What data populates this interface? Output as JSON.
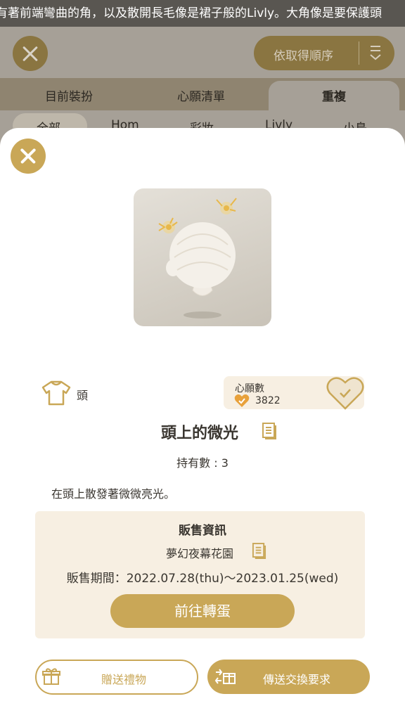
{
  "marquee": {
    "text": "有著前端彎曲的角，以及散開長毛像是裙子般的Livly。大角像是要保護頭"
  },
  "background_screen": {
    "sort_button_label": "依取得順序",
    "tabs": [
      "目前裝扮",
      "心願清單",
      "重複"
    ],
    "active_tab": "重複",
    "subtabs": [
      "全部",
      "Hom",
      "彩妝",
      "Livly",
      "小島"
    ]
  },
  "detail": {
    "category": "頭",
    "wishlist": {
      "label": "心願數",
      "count": "3822"
    },
    "item_name": "頭上的微光",
    "owned": "持有數 : 3",
    "description": "在頭上散發著微微亮光。",
    "sale": {
      "title": "販售資訊",
      "place": "夢幻夜幕花園",
      "period": "販售期間：2022.07.28(thu)～2023.01.25(wed)",
      "go_button": "前往轉蛋"
    },
    "gift_button": "贈送禮物",
    "trade_button": "傳送交換要求"
  },
  "colors": {
    "accent": "#c9a757",
    "panel": "#f7efe2",
    "text": "#3a3630",
    "heart": "#e8a13a"
  },
  "icons": [
    "close-icon",
    "sort-icon",
    "shirt-icon",
    "heart-icon",
    "document-icon",
    "gift-icon",
    "trade-icon"
  ]
}
